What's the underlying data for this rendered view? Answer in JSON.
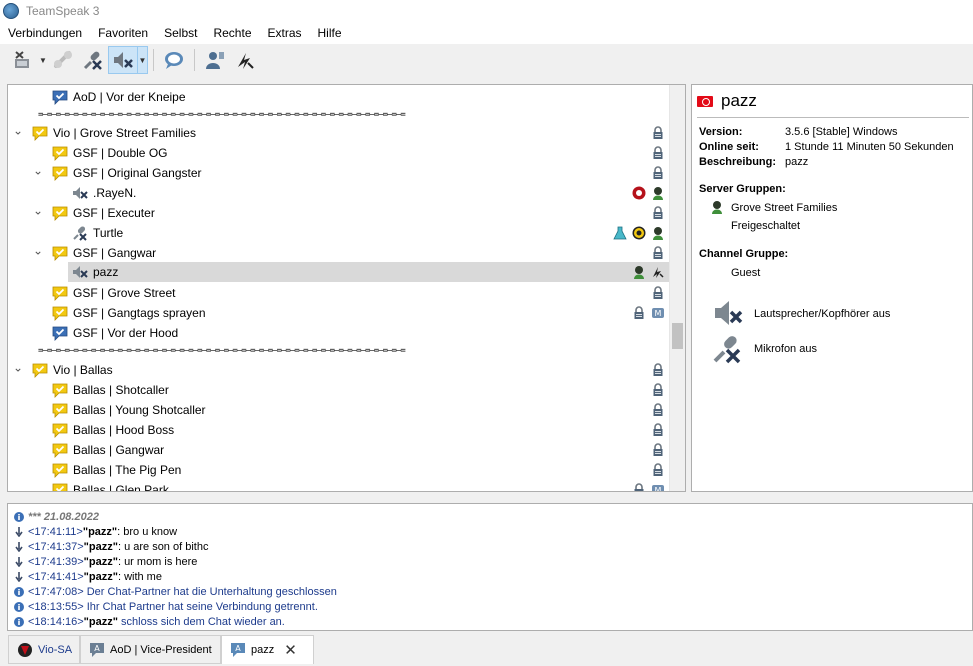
{
  "window": {
    "title": "TeamSpeak 3"
  },
  "menu": [
    "Verbindungen",
    "Favoriten",
    "Selbst",
    "Rechte",
    "Extras",
    "Hilfe"
  ],
  "toolbar": {
    "icons": [
      "disconnect-icon",
      "connect-disabled-icon",
      "mute-microphone-icon",
      "mute-speakers-icon",
      "chat-icon",
      "contacts-icon",
      "away-icon"
    ]
  },
  "tree": {
    "channels": [
      {
        "name": "AoD | Vor der Kneipe",
        "kind": "channel",
        "state": "blue"
      },
      {
        "kind": "spacer",
        "text": "=—=—=—=—=—=—=—=—=—=—=—=—=—=—=—=—=—=—=—=—=—=—=—=—=—=—=—=—=—=—=—=—=—=—=—=—=—=—=—=—=—="
      },
      {
        "name": "Vio | Grove Street Families",
        "kind": "channel",
        "state": "yellow",
        "expanded": true,
        "right": [
          "lock-icon"
        ]
      },
      {
        "name": "GSF | Double OG",
        "kind": "channel",
        "state": "yellow",
        "right": [
          "lock-icon"
        ]
      },
      {
        "name": "GSF | Original Gangster",
        "kind": "channel",
        "state": "yellow",
        "expanded": true,
        "right": [
          "lock-icon"
        ]
      },
      {
        "name": ".RayeN.",
        "kind": "client",
        "status": "speaker-muted",
        "right": [
          "red-badge-icon",
          "gang-group-icon"
        ]
      },
      {
        "name": "GSF | Executer",
        "kind": "channel",
        "state": "yellow",
        "expanded": true,
        "right": [
          "lock-icon"
        ]
      },
      {
        "name": "Turtle",
        "kind": "client",
        "status": "mic-muted",
        "right": [
          "flask-icon",
          "yellow-badge-icon",
          "gang-group-icon"
        ]
      },
      {
        "name": "GSF | Gangwar",
        "kind": "channel",
        "state": "yellow",
        "expanded": true,
        "right": [
          "lock-icon"
        ]
      },
      {
        "name": "pazz",
        "kind": "client",
        "status": "speaker-muted",
        "selected": true,
        "right": [
          "gang-group-icon",
          "away-icon"
        ]
      },
      {
        "name": "GSF | Grove Street",
        "kind": "channel",
        "state": "yellow",
        "right": [
          "lock-icon"
        ]
      },
      {
        "name": "GSF | Gangtags sprayen",
        "kind": "channel",
        "state": "yellow",
        "right": [
          "lock-icon",
          "moderated-icon"
        ]
      },
      {
        "name": "GSF | Vor der Hood",
        "kind": "channel",
        "state": "blue"
      },
      {
        "kind": "spacer",
        "text": "=—=—=—=—=—=—=—=—=—=—=—=—=—=—=—=—=—=—=—=—=—=—=—=—=—=—=—=—=—=—=—=—=—=—=—=—=—=—=—=—=—="
      },
      {
        "name": "Vio | Ballas",
        "kind": "channel",
        "state": "yellow",
        "expanded": true,
        "right": [
          "lock-icon"
        ]
      },
      {
        "name": "Ballas | Shotcaller",
        "kind": "channel",
        "state": "yellow",
        "right": [
          "lock-icon"
        ]
      },
      {
        "name": "Ballas | Young Shotcaller",
        "kind": "channel",
        "state": "yellow",
        "right": [
          "lock-icon"
        ]
      },
      {
        "name": "Ballas | Hood Boss",
        "kind": "channel",
        "state": "yellow",
        "right": [
          "lock-icon"
        ]
      },
      {
        "name": "Ballas | Gangwar",
        "kind": "channel",
        "state": "yellow",
        "right": [
          "lock-icon"
        ]
      },
      {
        "name": "Ballas | The Pig Pen",
        "kind": "channel",
        "state": "yellow",
        "right": [
          "lock-icon"
        ]
      },
      {
        "name": "Ballas | Glen Park",
        "kind": "channel",
        "state": "yellow",
        "right": [
          "lock-icon",
          "moderated-icon"
        ]
      }
    ]
  },
  "info": {
    "nickname": "pazz",
    "version_label": "Version:",
    "version_value": "3.5.6 [Stable] Windows",
    "online_label": "Online seit:",
    "online_value": "1 Stunde 11 Minuten 50 Sekunden",
    "desc_label": "Beschreibung:",
    "desc_value": "pazz",
    "server_groups_label": "Server Gruppen:",
    "server_group_1": "Grove Street Families",
    "server_group_2": "Freigeschaltet",
    "channel_group_label": "Channel Gruppe:",
    "channel_group": "Guest",
    "speaker_status": "Lautsprecher/Kopfhörer aus",
    "mic_status": "Mikrofon aus"
  },
  "chat": {
    "date_line": "*** 21.08.2022",
    "lines": [
      {
        "type": "in",
        "time": "<17:41:11>",
        "nick": "\"pazz\"",
        "text": ": bro u know"
      },
      {
        "type": "in",
        "time": "<17:41:37>",
        "nick": "\"pazz\"",
        "text": ": u are son of bithc"
      },
      {
        "type": "in",
        "time": "<17:41:39>",
        "nick": "\"pazz\"",
        "text": ": ur mom is here"
      },
      {
        "type": "in",
        "time": "<17:41:41>",
        "nick": "\"pazz\"",
        "text": ": with me"
      },
      {
        "type": "info",
        "time": "<17:47:08>",
        "nick": "",
        "text": " Der Chat-Partner hat die Unterhaltung geschlossen"
      },
      {
        "type": "info",
        "time": "<18:13:55>",
        "nick": "",
        "text": " Ihr Chat Partner hat seine Verbindung getrennt."
      },
      {
        "type": "info",
        "time": "<18:14:16>",
        "nick": "\"pazz\"",
        "text": " schloss sich dem Chat wieder an."
      }
    ]
  },
  "tabs": [
    {
      "label": "Vio-SA",
      "active": false
    },
    {
      "label": "AoD | Vice-President",
      "active": false
    },
    {
      "label": "pazz",
      "active": true
    }
  ],
  "colors": {
    "accent": "#1d3b8c",
    "selected_row": "#d9d9d9",
    "channel_yellow": "#f2c811",
    "channel_blue": "#3b6fb6"
  }
}
